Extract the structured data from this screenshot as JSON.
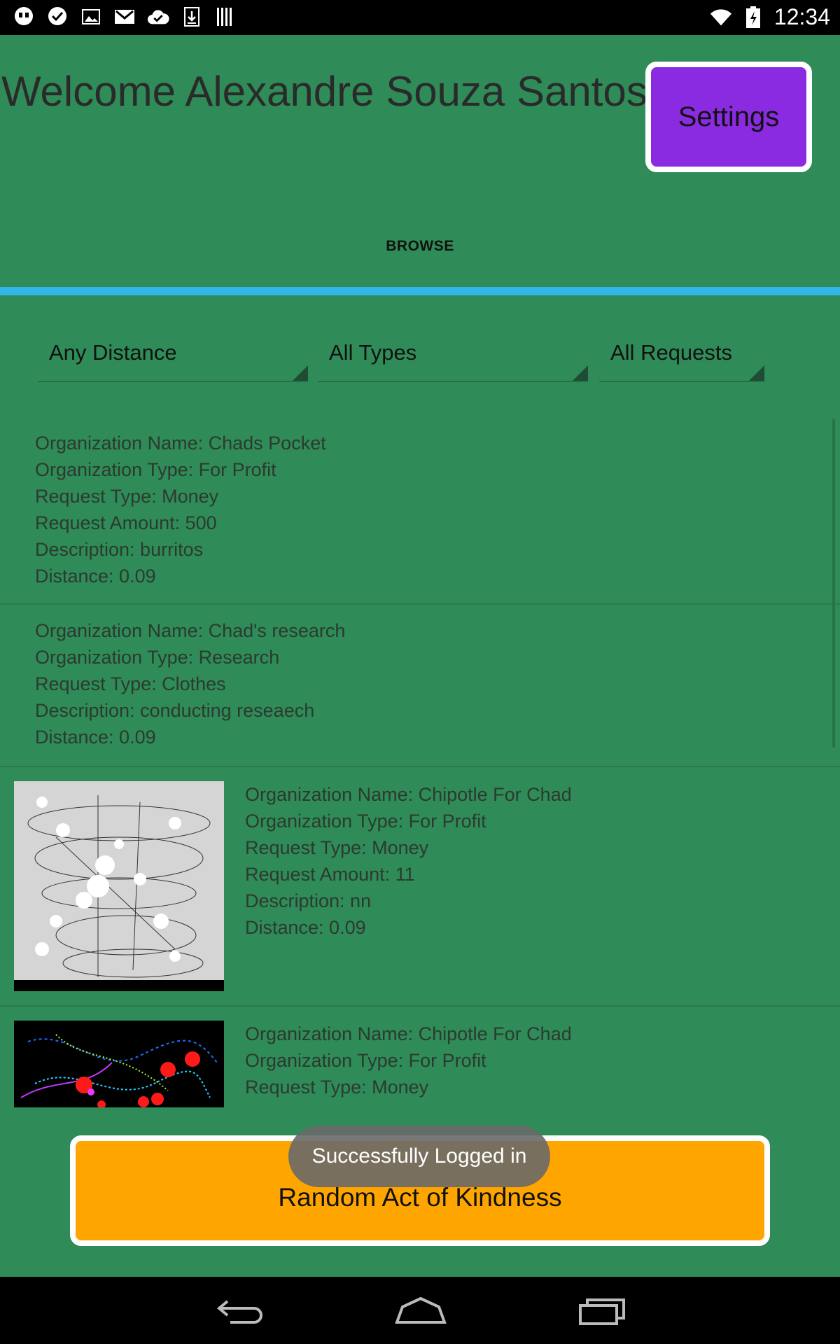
{
  "status_bar": {
    "time": "12:34",
    "left_icons": [
      "hangouts-icon",
      "checkmark-icon",
      "image-icon",
      "gmail-icon",
      "cloud-check-icon",
      "download-icon",
      "barcode-icon"
    ],
    "right_icons": [
      "wifi-icon",
      "battery-icon"
    ]
  },
  "header": {
    "welcome_text": "Welcome Alexandre Souza Santos",
    "settings_label": "Settings",
    "settings_color": "#8a2be2"
  },
  "tabs": [
    {
      "label": "BROWSE",
      "selected": true
    }
  ],
  "accent_color": "#33b5e5",
  "filters": [
    {
      "value": "Any Distance"
    },
    {
      "value": "All Types"
    },
    {
      "value": "All Requests"
    }
  ],
  "requests": [
    {
      "has_image": false,
      "lines": [
        "Organization Name: Chads Pocket",
        "Organization Type: For Profit",
        "Request Type: Money",
        "Request Amount: 500",
        "Description: burritos",
        "Distance: 0.09"
      ]
    },
    {
      "has_image": false,
      "lines": [
        "Organization Name: Chad's research",
        "Organization Type: Research",
        "Request Type: Clothes",
        "Description: conducting reseaech",
        "Distance: 0.09"
      ]
    },
    {
      "has_image": true,
      "image": "light-sketch-thumbnail",
      "lines": [
        "Organization Name: Chipotle For Chad",
        "Organization Type: For Profit",
        "Request Type: Money",
        "Request Amount: 11",
        "Description: nn",
        "Distance: 0.09"
      ]
    },
    {
      "has_image": true,
      "image": "dark-sketch-thumbnail",
      "lines": [
        "Organization Name: Chipotle For Chad",
        "Organization Type: For Profit",
        "Request Type: Money"
      ]
    }
  ],
  "random_act_button": {
    "label": "Random Act of Kindness",
    "color": "#ffa500"
  },
  "toast": {
    "message": "Successfully Logged in"
  },
  "nav_bar": {
    "buttons": [
      "back-icon",
      "home-icon",
      "recents-icon"
    ]
  }
}
